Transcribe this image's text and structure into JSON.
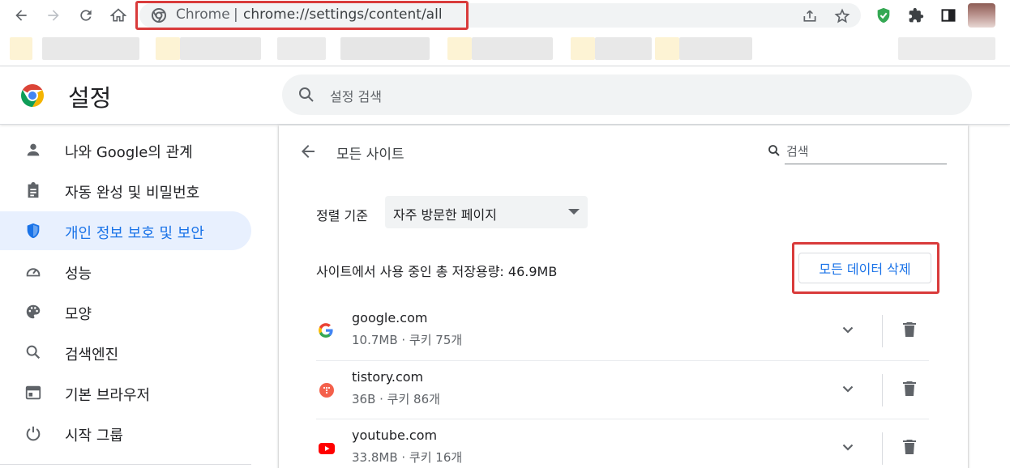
{
  "browser": {
    "omnibox_label": "Chrome",
    "omnibox_separator": "|",
    "url": "chrome://settings/content/all"
  },
  "header": {
    "title": "설정",
    "search_placeholder": "설정 검색"
  },
  "sidebar": {
    "items": [
      {
        "label": "나와 Google의 관계",
        "icon": "person-icon",
        "active": false
      },
      {
        "label": "자동 완성 및 비밀번호",
        "icon": "clipboard-icon",
        "active": false
      },
      {
        "label": "개인 정보 보호 및 보안",
        "icon": "shield-icon",
        "active": true
      },
      {
        "label": "성능",
        "icon": "speedometer-icon",
        "active": false
      },
      {
        "label": "모양",
        "icon": "palette-icon",
        "active": false
      },
      {
        "label": "검색엔진",
        "icon": "search-icon",
        "active": false
      },
      {
        "label": "기본 브라우저",
        "icon": "browser-window-icon",
        "active": false
      },
      {
        "label": "시작 그룹",
        "icon": "power-icon",
        "active": false
      }
    ]
  },
  "main": {
    "title": "모든 사이트",
    "search_placeholder": "검색",
    "sort_label": "정렬 기준",
    "sort_value": "자주 방문한 페이지",
    "storage_text": "사이트에서 사용 중인 총 저장용량: 46.9MB",
    "clear_button": "모든 데이터 삭제",
    "sites": [
      {
        "name": "google.com",
        "meta": "10.7MB · 쿠키 75개",
        "favicon": "google-favicon"
      },
      {
        "name": "tistory.com",
        "meta": "36B · 쿠키 86개",
        "favicon": "tistory-favicon"
      },
      {
        "name": "youtube.com",
        "meta": "33.8MB · 쿠키 16개",
        "favicon": "youtube-favicon"
      }
    ]
  },
  "colors": {
    "accent": "#1a73e8",
    "active_bg": "#e8f0fe",
    "highlight": "#d93b3b"
  }
}
